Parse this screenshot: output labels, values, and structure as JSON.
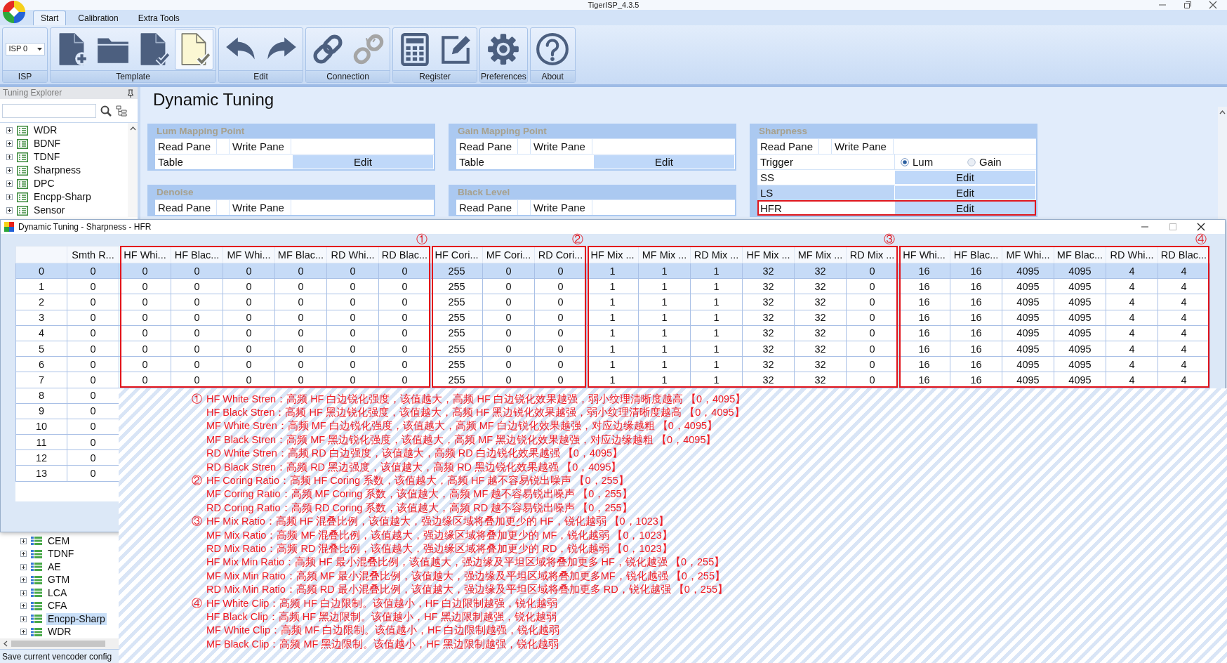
{
  "window": {
    "title": "TigerISP_4.3.5"
  },
  "ribbon": {
    "tabs": [
      {
        "label": "Start",
        "selected": true
      },
      {
        "label": "Calibration",
        "selected": false
      },
      {
        "label": "Extra Tools",
        "selected": false
      }
    ],
    "groups": [
      {
        "label": "ISP",
        "kind": "selector",
        "value": "ISP 0"
      },
      {
        "label": "Template",
        "kind": "buttons",
        "buttons": [
          {
            "selected": false,
            "disabled": false
          },
          {
            "selected": false,
            "disabled": false
          },
          {
            "selected": false,
            "disabled": false
          },
          {
            "selected": true,
            "disabled": false
          }
        ]
      },
      {
        "label": "Edit",
        "kind": "buttons",
        "buttons": [
          {
            "selected": false,
            "disabled": false
          },
          {
            "selected": false,
            "disabled": false
          }
        ]
      },
      {
        "label": "Connection",
        "kind": "buttons",
        "buttons": [
          {
            "selected": false,
            "disabled": false
          },
          {
            "selected": false,
            "disabled": true
          }
        ]
      },
      {
        "label": "Register",
        "kind": "buttons",
        "buttons": [
          {
            "selected": false,
            "disabled": false
          },
          {
            "selected": false,
            "disabled": false
          }
        ]
      },
      {
        "label": "Preferences",
        "kind": "buttons",
        "buttons": [
          {
            "selected": false,
            "disabled": false
          }
        ]
      },
      {
        "label": "About",
        "kind": "buttons",
        "buttons": [
          {
            "selected": false,
            "disabled": false
          }
        ]
      }
    ]
  },
  "explorer": {
    "title": "Tuning Explorer",
    "tree": [
      {
        "label": "WDR",
        "expanded": false,
        "selected": false
      },
      {
        "label": "BDNF",
        "expanded": false,
        "selected": false
      },
      {
        "label": "TDNF",
        "expanded": false,
        "selected": false
      },
      {
        "label": "Sharpness",
        "expanded": false,
        "selected": false
      },
      {
        "label": "DPC",
        "expanded": false,
        "selected": false
      },
      {
        "label": "Encpp-Sharp",
        "expanded": false,
        "selected": false
      },
      {
        "label": "Sensor",
        "expanded": false,
        "selected": false
      }
    ],
    "tree_below_dialog": [
      {
        "label": "CEM",
        "expanded": false,
        "selected": false
      },
      {
        "label": "TDNF",
        "expanded": false,
        "selected": false
      },
      {
        "label": "AE",
        "expanded": false,
        "selected": false
      },
      {
        "label": "GTM",
        "expanded": false,
        "selected": false
      },
      {
        "label": "LCA",
        "expanded": false,
        "selected": false
      },
      {
        "label": "CFA",
        "expanded": false,
        "selected": false
      },
      {
        "label": "Encpp-Sharp",
        "expanded": false,
        "selected": true
      },
      {
        "label": "WDR",
        "expanded": false,
        "selected": false
      }
    ]
  },
  "content": {
    "title": "Dynamic Tuning",
    "panel_columns": [
      {
        "panels": [
          {
            "title": "Lum Mapping Point",
            "rows": [
              {
                "kind": "panes",
                "read": "Read Pane",
                "write": "Write Pane"
              },
              {
                "kind": "edit",
                "label": "Table",
                "button": "Edit",
                "selected": false,
                "highlighted": false
              }
            ]
          },
          {
            "title": "Denoise",
            "rows": [
              {
                "kind": "panes",
                "read": "Read Pane",
                "write": "Write Pane"
              }
            ]
          }
        ]
      },
      {
        "panels": [
          {
            "title": "Gain Mapping Point",
            "rows": [
              {
                "kind": "panes",
                "read": "Read Pane",
                "write": "Write Pane"
              },
              {
                "kind": "edit",
                "label": "Table",
                "button": "Edit",
                "selected": false,
                "highlighted": false
              }
            ]
          },
          {
            "title": "Black Level",
            "rows": [
              {
                "kind": "panes",
                "read": "Read Pane",
                "write": "Write Pane"
              }
            ]
          }
        ]
      },
      {
        "panels": [
          {
            "title": "Sharpness",
            "rows": [
              {
                "kind": "panes",
                "read": "Read Pane",
                "write": "Write Pane"
              },
              {
                "kind": "choice",
                "label": "Trigger",
                "options": [
                  {
                    "label": "Lum",
                    "selected": true
                  },
                  {
                    "label": "Gain",
                    "selected": false
                  }
                ]
              },
              {
                "kind": "edit",
                "label": "SS",
                "button": "Edit",
                "selected": false,
                "highlighted": false
              },
              {
                "kind": "edit",
                "label": "LS",
                "button": "Edit",
                "selected": true,
                "highlighted": false
              },
              {
                "kind": "edit",
                "label": "HFR",
                "button": "Edit",
                "selected": false,
                "highlighted": true
              }
            ]
          }
        ]
      }
    ]
  },
  "dialog": {
    "title": "Dynamic Tuning - Sharpness - HFR",
    "table": {
      "column_groups": [
        {
          "columns": [
            "Smth R..."
          ]
        },
        {
          "marker": "①",
          "columns": [
            "HF Whi...",
            "HF Blac...",
            "MF Whi...",
            "MF Blac...",
            "RD Whi...",
            "RD Blac..."
          ]
        },
        {
          "marker": "②",
          "columns": [
            "HF Cori...",
            "MF Cori...",
            "RD Cori..."
          ]
        },
        {
          "marker": "③",
          "columns": [
            "HF Mix ...",
            "MF Mix ...",
            "RD Mix ...",
            "HF Mix ...",
            "MF Mix ...",
            "RD Mix ..."
          ]
        },
        {
          "marker": "④",
          "columns": [
            "HF Whi...",
            "HF Blac...",
            "MF Whi...",
            "MF Blac...",
            "RD Whi...",
            "RD Blac..."
          ]
        }
      ],
      "rows": [
        {
          "label": "0",
          "selected": true,
          "cells": [
            "0",
            "0",
            "0",
            "0",
            "0",
            "0",
            "0",
            "255",
            "0",
            "0",
            "1",
            "1",
            "1",
            "32",
            "32",
            "0",
            "16",
            "16",
            "4095",
            "4095",
            "4",
            "4"
          ]
        },
        {
          "label": "1",
          "selected": false,
          "cells": [
            "0",
            "0",
            "0",
            "0",
            "0",
            "0",
            "0",
            "255",
            "0",
            "0",
            "1",
            "1",
            "1",
            "32",
            "32",
            "0",
            "16",
            "16",
            "4095",
            "4095",
            "4",
            "4"
          ]
        },
        {
          "label": "2",
          "selected": false,
          "cells": [
            "0",
            "0",
            "0",
            "0",
            "0",
            "0",
            "0",
            "255",
            "0",
            "0",
            "1",
            "1",
            "1",
            "32",
            "32",
            "0",
            "16",
            "16",
            "4095",
            "4095",
            "4",
            "4"
          ]
        },
        {
          "label": "3",
          "selected": false,
          "cells": [
            "0",
            "0",
            "0",
            "0",
            "0",
            "0",
            "0",
            "255",
            "0",
            "0",
            "1",
            "1",
            "1",
            "32",
            "32",
            "0",
            "16",
            "16",
            "4095",
            "4095",
            "4",
            "4"
          ]
        },
        {
          "label": "4",
          "selected": false,
          "cells": [
            "0",
            "0",
            "0",
            "0",
            "0",
            "0",
            "0",
            "255",
            "0",
            "0",
            "1",
            "1",
            "1",
            "32",
            "32",
            "0",
            "16",
            "16",
            "4095",
            "4095",
            "4",
            "4"
          ]
        },
        {
          "label": "5",
          "selected": false,
          "cells": [
            "0",
            "0",
            "0",
            "0",
            "0",
            "0",
            "0",
            "255",
            "0",
            "0",
            "1",
            "1",
            "1",
            "32",
            "32",
            "0",
            "16",
            "16",
            "4095",
            "4095",
            "4",
            "4"
          ]
        },
        {
          "label": "6",
          "selected": false,
          "cells": [
            "0",
            "0",
            "0",
            "0",
            "0",
            "0",
            "0",
            "255",
            "0",
            "0",
            "1",
            "1",
            "1",
            "32",
            "32",
            "0",
            "16",
            "16",
            "4095",
            "4095",
            "4",
            "4"
          ]
        },
        {
          "label": "7",
          "selected": false,
          "cells": [
            "0",
            "0",
            "0",
            "0",
            "0",
            "0",
            "0",
            "255",
            "0",
            "0",
            "1",
            "1",
            "1",
            "32",
            "32",
            "0",
            "16",
            "16",
            "4095",
            "4095",
            "4",
            "4"
          ]
        },
        {
          "label": "8",
          "selected": false,
          "cells": [
            "0"
          ]
        },
        {
          "label": "9",
          "selected": false,
          "cells": [
            "0"
          ]
        },
        {
          "label": "10",
          "selected": false,
          "cells": [
            "0"
          ]
        },
        {
          "label": "11",
          "selected": false,
          "cells": [
            "0"
          ]
        },
        {
          "label": "12",
          "selected": false,
          "cells": [
            "0"
          ]
        },
        {
          "label": "13",
          "selected": false,
          "cells": [
            "0"
          ]
        }
      ]
    }
  },
  "notes": [
    {
      "marker": "①",
      "lines": [
        "HF White Stren：高频 HF 白边锐化强度，该值越大，高频 HF 白边锐化效果越强，弱小纹理清晰度越高 【0，4095】",
        "HF Black Stren：高频 HF 黑边锐化强度，该值越大，高频 HF 黑边锐化效果越强，弱小纹理清晰度越高 【0，4095】",
        "MF White Stren：高频 MF 白边锐化强度，该值越大，高频 MF 白边锐化效果越强，对应边缘越粗 【0，4095】",
        "MF Black Stren：高频 MF 黑边锐化强度，该值越大，高频 MF 黑边锐化效果越强，对应边缘越粗 【0，4095】",
        "RD White Stren：高频 RD 白边强度，该值越大，高频 RD 白边锐化效果越强 【0，4095】",
        "RD Black Stren：高频 RD 黑边强度，该值越大，高频 RD 黑边锐化效果越强 【0，4095】"
      ]
    },
    {
      "marker": "②",
      "lines": [
        "HF Coring Ratio：高频 HF Coring 系数，该值越大，高频 HF 越不容易锐出噪声 【0，255】",
        "MF Coring Ratio：高频 MF Coring 系数，该值越大，高频 MF 越不容易锐出噪声 【0，255】",
        "RD Coring Ratio：高频 RD Coring 系数，该值越大，高频 RD 越不容易锐出噪声 【0，255】"
      ]
    },
    {
      "marker": "③",
      "lines": [
        "HF Mix Ratio：高频 HF 混叠比例，该值越大，强边缘区域将叠加更少的 HF，锐化越弱 【0，1023】",
        "MF Mix Ratio：高频 MF 混叠比例，该值越大，强边缘区域将叠加更少的 MF，锐化越弱 【0，1023】",
        "RD Mix Ratio：高频 RD 混叠比例，该值越大，强边缘区域将叠加更少的 RD，锐化越弱 【0，1023】",
        "HF Mix Min Ratio：高频 HF 最小混叠比例，该值越大，强边缘及平坦区域将叠加更多 HF，锐化越强 【0，255】",
        "MF Mix Min Ratio：高频 MF 最小混叠比例，该值越大，强边缘及平坦区域将叠加更多MF，锐化越强 【0，255】",
        "RD Mix Min Ratio：高频 RD 最小混叠比例，该值越大，强边缘及平坦区域将叠加更多 RD，锐化越强 【0，255】"
      ]
    },
    {
      "marker": "④",
      "lines": [
        "HF White Clip：高频 HF 白边限制。该值越小，HF 白边限制越强，锐化越弱",
        "HF Black Clip：高频 HF 黑边限制。该值越小，HF 黑边限制越强，锐化越弱",
        "MF White Clip：高频 MF 白边限制。该值越小，HF 白边限制越强，锐化越弱",
        "MF Black Clip：高频 MF 黑边限制。该值越小，HF 黑边限制越强，锐化越弱"
      ]
    }
  ],
  "status_bar": {
    "text": "Save current vencoder config"
  }
}
